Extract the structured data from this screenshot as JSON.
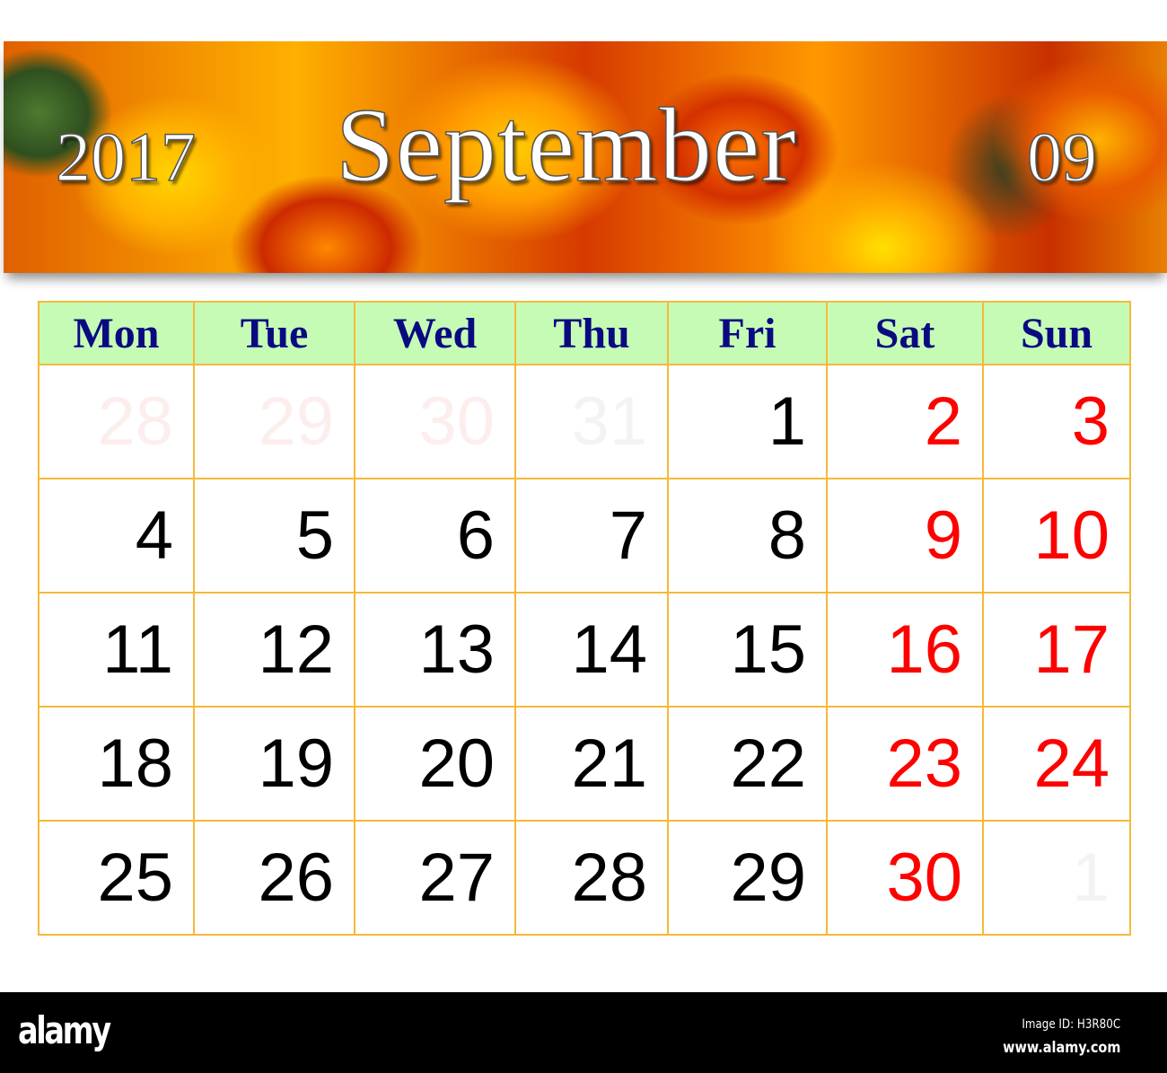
{
  "header": {
    "year": "2017",
    "month": "September",
    "month_number": "09"
  },
  "weekdays": [
    "Mon",
    "Tue",
    "Wed",
    "Thu",
    "Fri",
    "Sat",
    "Sun"
  ],
  "weeks": [
    [
      {
        "day": "28",
        "type": "prev"
      },
      {
        "day": "29",
        "type": "prev"
      },
      {
        "day": "30",
        "type": "prev"
      },
      {
        "day": "31",
        "type": "prev"
      },
      {
        "day": "1",
        "type": "weekday"
      },
      {
        "day": "2",
        "type": "weekend"
      },
      {
        "day": "3",
        "type": "weekend"
      }
    ],
    [
      {
        "day": "4",
        "type": "weekday"
      },
      {
        "day": "5",
        "type": "weekday"
      },
      {
        "day": "6",
        "type": "weekday"
      },
      {
        "day": "7",
        "type": "weekday"
      },
      {
        "day": "8",
        "type": "weekday"
      },
      {
        "day": "9",
        "type": "weekend"
      },
      {
        "day": "10",
        "type": "weekend"
      }
    ],
    [
      {
        "day": "11",
        "type": "weekday"
      },
      {
        "day": "12",
        "type": "weekday"
      },
      {
        "day": "13",
        "type": "weekday"
      },
      {
        "day": "14",
        "type": "weekday"
      },
      {
        "day": "15",
        "type": "weekday"
      },
      {
        "day": "16",
        "type": "weekend"
      },
      {
        "day": "17",
        "type": "weekend"
      }
    ],
    [
      {
        "day": "18",
        "type": "weekday"
      },
      {
        "day": "19",
        "type": "weekday"
      },
      {
        "day": "20",
        "type": "weekday"
      },
      {
        "day": "21",
        "type": "weekday"
      },
      {
        "day": "22",
        "type": "weekday"
      },
      {
        "day": "23",
        "type": "weekend"
      },
      {
        "day": "24",
        "type": "weekend"
      }
    ],
    [
      {
        "day": "25",
        "type": "weekday"
      },
      {
        "day": "26",
        "type": "weekday"
      },
      {
        "day": "27",
        "type": "weekday"
      },
      {
        "day": "28",
        "type": "weekday"
      },
      {
        "day": "29",
        "type": "weekday"
      },
      {
        "day": "30",
        "type": "weekend"
      },
      {
        "day": "1",
        "type": "next"
      }
    ]
  ],
  "colors": {
    "weekday_header_bg": "#c6fbb6",
    "weekday_header_text": "#0a0a80",
    "grid_border": "#f6b93b",
    "weekend_text": "#ff0000",
    "weekday_text": "#000000"
  },
  "footer": {
    "logo": "alamy",
    "image_id": "Image ID: H3R80C",
    "site": "www.alamy.com"
  }
}
